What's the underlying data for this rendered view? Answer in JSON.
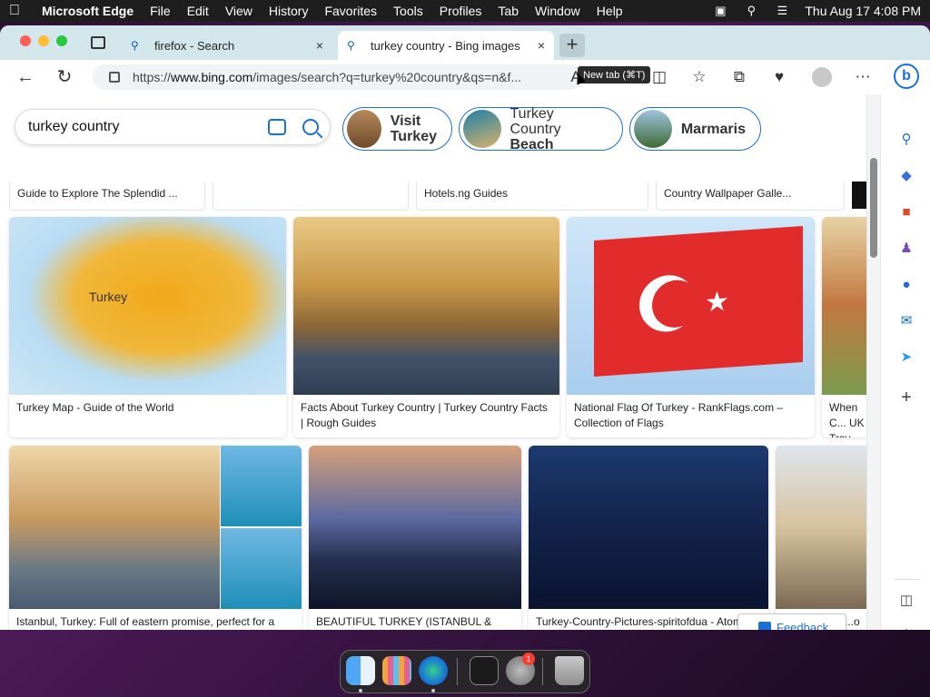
{
  "menubar": {
    "app_name": "Microsoft Edge",
    "items": [
      "File",
      "Edit",
      "View",
      "History",
      "Favorites",
      "Tools",
      "Profiles",
      "Tab",
      "Window",
      "Help"
    ],
    "clock": "Thu Aug 17  4:08 PM"
  },
  "tabs": [
    {
      "title": "firefox - Search",
      "close": "×"
    },
    {
      "title": "turkey country - Bing images",
      "close": "×"
    }
  ],
  "new_tab_tooltip": "New tab (⌘T)",
  "address_bar": {
    "url_prefix": "https://",
    "url_domain": "www.bing.com",
    "url_rest": "/images/search?q=turkey%20country&qs=n&f...",
    "read_aloud_glyph": "A"
  },
  "search": {
    "query": "turkey country"
  },
  "related_chips": [
    {
      "line1": "Visit",
      "line2": "Turkey"
    },
    {
      "line1": "Turkey Country",
      "line2": "Beach"
    },
    {
      "line1": "Marmaris",
      "line2": ""
    }
  ],
  "top_captions": [
    "Guide to Explore The Splendid ...",
    "",
    "Hotels.ng Guides",
    "Country Wallpaper Galle..."
  ],
  "row1": [
    {
      "caption": "Turkey Map - Guide of the World",
      "overlay": "Turkey"
    },
    {
      "caption": "Facts About Turkey Country | Turkey Country Facts | Rough Guides"
    },
    {
      "caption": "National Flag Of Turkey - RankFlags.com – Collection of Flags"
    },
    {
      "caption": "When C... UK Trav..."
    }
  ],
  "row2": [
    {
      "caption": "Istanbul, Turkey: Full of eastern promise, perfect for a weekend mini ..."
    },
    {
      "caption": "BEAUTIFUL TURKEY (ISTANBUL & CAPPADOCIA) | Evergreen Travels"
    },
    {
      "caption": "Turkey-Country-Pictures-spiritofdua - Atom Travel"
    },
    {
      "caption": "...o G... ...tica..."
    }
  ],
  "feedback_label": "Feedback",
  "dock": {
    "badge_count": "1"
  },
  "colors": {
    "accent": "#1a6fd8",
    "tabbar": "#d3e6eb",
    "flag_red": "#e22b2b"
  }
}
